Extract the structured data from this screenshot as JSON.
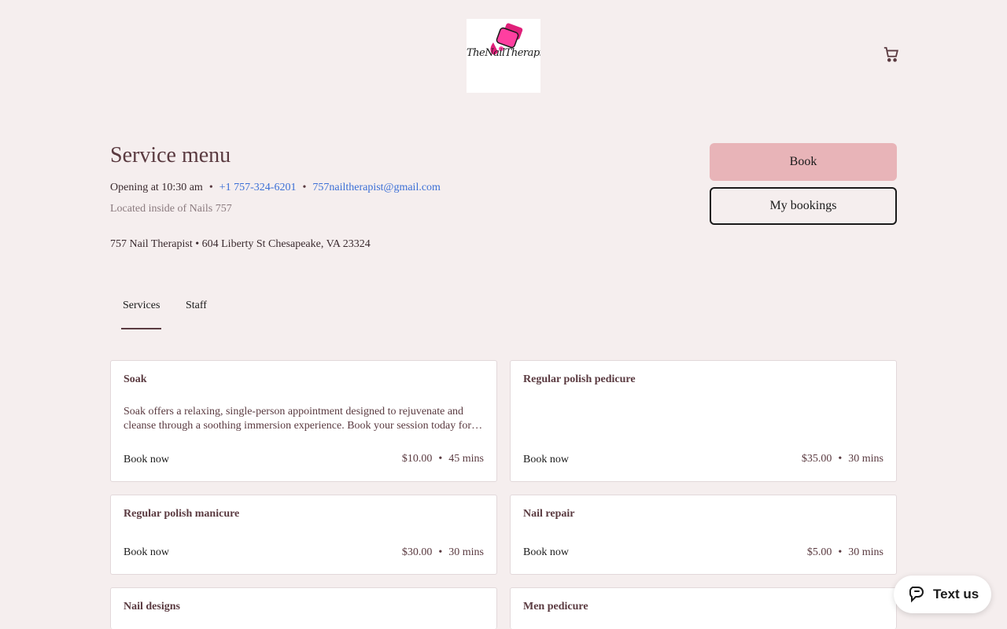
{
  "header": {
    "logo_text": "TheNailTherapist",
    "cart_icon": "cart-icon"
  },
  "page": {
    "title": "Service menu",
    "opening": "Opening at 10:30 am",
    "phone": "+1 757-324-6201",
    "email": "757nailtherapist@gmail.com",
    "located": "Located inside of Nails 757",
    "address": "757 Nail Therapist • 604 Liberty St Chesapeake, VA 23324",
    "separator": "•"
  },
  "actions": {
    "book_label": "Book",
    "my_bookings_label": "My bookings"
  },
  "tabs": [
    {
      "label": "Services",
      "active": true
    },
    {
      "label": "Staff",
      "active": false
    }
  ],
  "services": [
    {
      "name": "Soak",
      "description": "Soak offers a relaxing, single-person appointment designed to rejuvenate and cleanse through a soothing immersion experience. Book your session today for…",
      "book_label": "Book now",
      "price": "$10.00",
      "duration": "45 mins"
    },
    {
      "name": "Regular polish pedicure",
      "description": "",
      "book_label": "Book now",
      "price": "$35.00",
      "duration": "30 mins"
    },
    {
      "name": "Regular polish manicure",
      "description": "",
      "book_label": "Book now",
      "price": "$30.00",
      "duration": "30 mins"
    },
    {
      "name": "Nail repair",
      "description": "",
      "book_label": "Book now",
      "price": "$5.00",
      "duration": "30 mins"
    },
    {
      "name": "Nail designs",
      "description": "",
      "book_label": "",
      "price": "",
      "duration": ""
    },
    {
      "name": "Men pedicure",
      "description": "",
      "book_label": "",
      "price": "",
      "duration": ""
    }
  ],
  "chat": {
    "label": "Text us",
    "icon": "chat-bubble-icon"
  },
  "colors": {
    "background": "#f5eeee",
    "accent": "#e8b4b8",
    "text": "#5a3a40",
    "link": "#3b6fd6"
  }
}
